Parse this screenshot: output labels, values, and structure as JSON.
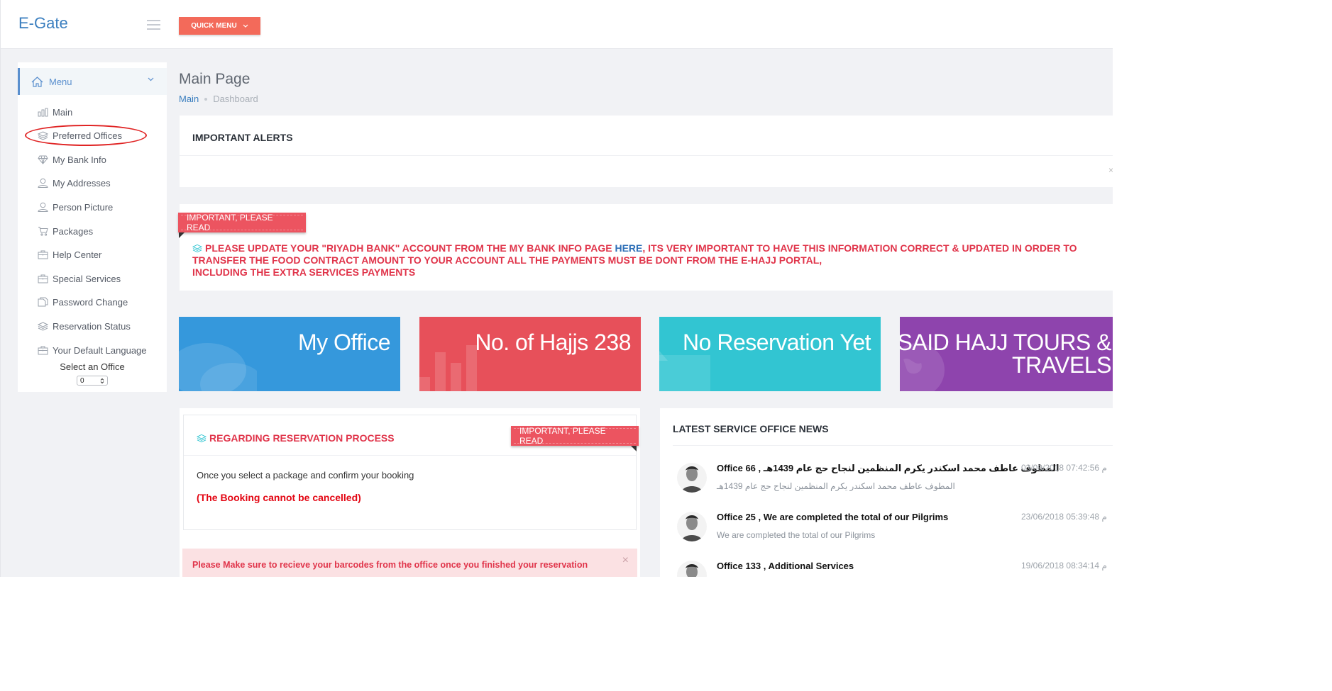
{
  "app": {
    "title": "E-Gate",
    "quick_menu_label": "QUICK MENU"
  },
  "sidebar": {
    "menu_label": "Menu",
    "items": [
      {
        "label": "Main",
        "icon": "bar-chart-icon"
      },
      {
        "label": "Preferred Offices",
        "icon": "layers-icon"
      },
      {
        "label": "My Bank Info",
        "icon": "diamond-icon"
      },
      {
        "label": "My Addresses",
        "icon": "user-icon"
      },
      {
        "label": "Person Picture",
        "icon": "user-icon"
      },
      {
        "label": "Packages",
        "icon": "cart-icon"
      },
      {
        "label": "Help Center",
        "icon": "briefcase-icon"
      },
      {
        "label": "Special Services",
        "icon": "briefcase-icon"
      },
      {
        "label": "Password Change",
        "icon": "docs-icon"
      },
      {
        "label": "Reservation Status",
        "icon": "layers-icon"
      },
      {
        "label": "Your Default Language",
        "icon": "briefcase-icon"
      }
    ],
    "select_office_label": "Select an Office",
    "select_office_value": "0"
  },
  "page": {
    "title": "Main Page",
    "breadcrumb": [
      "Main",
      "Dashboard"
    ]
  },
  "alerts": {
    "title": "IMPORTANT ALERTS",
    "close": "×"
  },
  "bank_notice": {
    "ribbon": "IMPORTANT, PLEASE READ",
    "text_before": "PLEASE UPDATE YOUR \"RIYADH BANK\" ACCOUNT FROM THE MY BANK INFO PAGE ",
    "link": "HERE",
    "text_after": ", ITS VERY IMPORTANT TO HAVE THIS INFORMATION CORRECT & UPDATED IN ORDER TO TRANSFER THE FOOD CONTRACT AMOUNT TO YOUR ACCOUNT ALL THE PAYMENTS MUST BE DONT FROM THE E-HAJJ PORTAL,",
    "text_line3": "INCLUDING THE EXTRA SERVICES PAYMENTS"
  },
  "tiles": {
    "office": "My Office",
    "hajjs": "No. of Hajjs 238",
    "reservation": "No Reservation Yet",
    "said_line1": "SAID HAJJ TOURS &",
    "said_line2": "TRAVELS",
    "colors": {
      "office": "#3598dc",
      "hajjs": "#e7505a",
      "reservation": "#32c5d2",
      "said": "#8e44ad"
    }
  },
  "reservation": {
    "title": "REGARDING RESERVATION PROCESS",
    "ribbon": "IMPORTANT, PLEASE READ",
    "line1": "Once you select a package and confirm your booking",
    "line2": "(The Booking cannot be cancelled)"
  },
  "barcode_alert": {
    "text": "Please Make sure to recieve your barcodes from the office once you finished your reservation",
    "close": "×"
  },
  "news": {
    "title": "LATEST SERVICE OFFICE NEWS",
    "items": [
      {
        "headline": "Office 66 , المطوف عاطف محمد اسكندر يكرم المنظمين لنجاح حج عام 1439هـ",
        "summary": "المطوف عاطف محمد اسكندر يكرم المنظمين لنجاح حج عام 1439هـ",
        "date": "03/09/2018 07:42:56 م"
      },
      {
        "headline": "Office 25 , We are completed the total of our Pilgrims",
        "summary": "We are completed the total of our Pilgrims",
        "date": "23/06/2018 05:39:48 م"
      },
      {
        "headline": "Office 133 , Additional Services",
        "summary": "",
        "date": "19/06/2018 08:34:14 م"
      }
    ]
  }
}
